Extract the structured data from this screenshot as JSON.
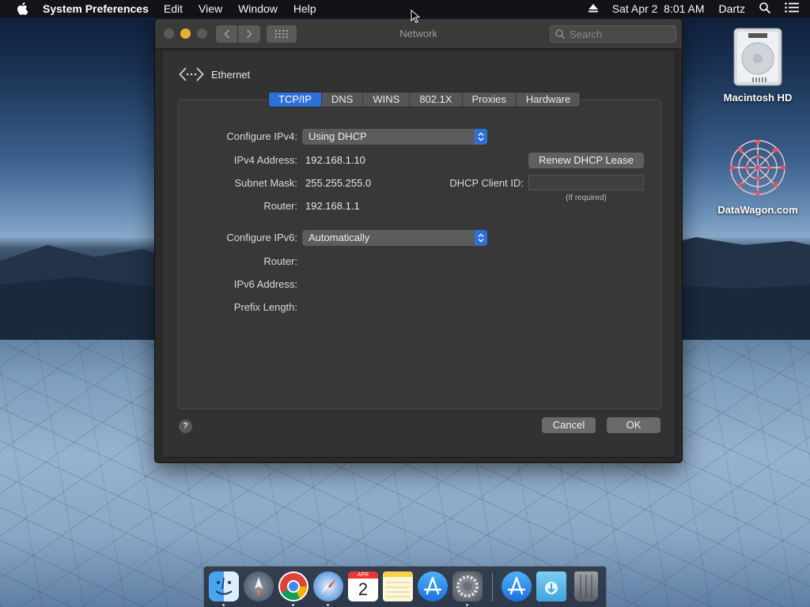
{
  "menubar": {
    "app_name": "System Preferences",
    "menus": [
      "Edit",
      "View",
      "Window",
      "Help"
    ],
    "datetime": "Sat Apr 2  8:01 AM",
    "user": "Dartz"
  },
  "window": {
    "title": "Network",
    "search_placeholder": "Search",
    "interface_name": "Ethernet",
    "tabs": [
      "TCP/IP",
      "DNS",
      "WINS",
      "802.1X",
      "Proxies",
      "Hardware"
    ],
    "active_tab": "TCP/IP",
    "ipv4": {
      "configure_label": "Configure IPv4:",
      "configure_value": "Using DHCP",
      "address_label": "IPv4 Address:",
      "address_value": "192.168.1.10",
      "subnet_label": "Subnet Mask:",
      "subnet_value": "255.255.255.0",
      "router_label": "Router:",
      "router_value": "192.168.1.1"
    },
    "dhcp": {
      "renew_label": "Renew DHCP Lease",
      "client_id_label": "DHCP Client ID:",
      "client_id_value": "",
      "hint": "(If required)"
    },
    "ipv6": {
      "configure_label": "Configure IPv6:",
      "configure_value": "Automatically",
      "router_label": "Router:",
      "address_label": "IPv6 Address:",
      "prefix_label": "Prefix Length:"
    },
    "help_label": "?",
    "cancel_label": "Cancel",
    "ok_label": "OK"
  },
  "desktop": {
    "icons": [
      {
        "label": "Macintosh HD",
        "icon": "hard-drive-icon"
      },
      {
        "label": "DataWagon.com",
        "icon": "datawagon-logo-icon"
      }
    ]
  },
  "dock": {
    "calendar_month": "APR",
    "calendar_day": "2",
    "items": [
      "finder-icon",
      "launchpad-icon",
      "chrome-icon",
      "safari-icon",
      "calendar-icon",
      "notes-icon",
      "app-store-icon",
      "system-preferences-icon",
      "app-store-downloads-icon",
      "downloads-folder-icon",
      "trash-icon"
    ]
  }
}
